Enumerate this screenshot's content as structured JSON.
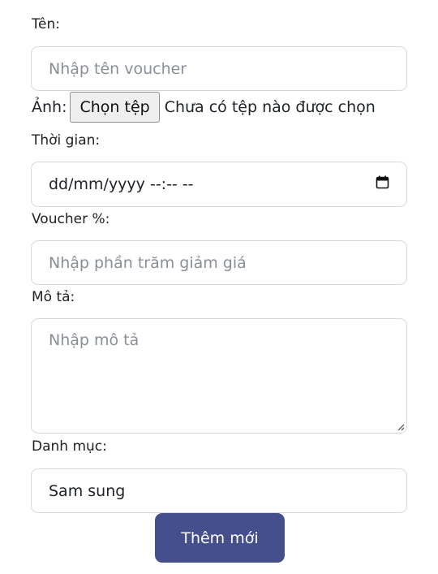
{
  "form": {
    "name": {
      "label": "Tên:",
      "placeholder": "Nhập tên voucher"
    },
    "image": {
      "label": "Ảnh:",
      "button_label": "Chọn tệp",
      "status": "Chưa có tệp nào được chọn"
    },
    "time": {
      "label": "Thời gian:",
      "value": "dd/mm/yyyy --:-- --",
      "icon": "calendar-icon"
    },
    "voucher_percent": {
      "label": "Voucher %:",
      "placeholder": "Nhập phần trăm giảm giá"
    },
    "description": {
      "label": "Mô tả:",
      "placeholder": "Nhập mô tả"
    },
    "category": {
      "label": "Danh mục:",
      "value": "Sam sung"
    },
    "submit_label": "Thêm mới"
  },
  "colors": {
    "submit_bg": "#454f8c",
    "field_border": "#d6d9de",
    "placeholder": "#8a8f97"
  }
}
